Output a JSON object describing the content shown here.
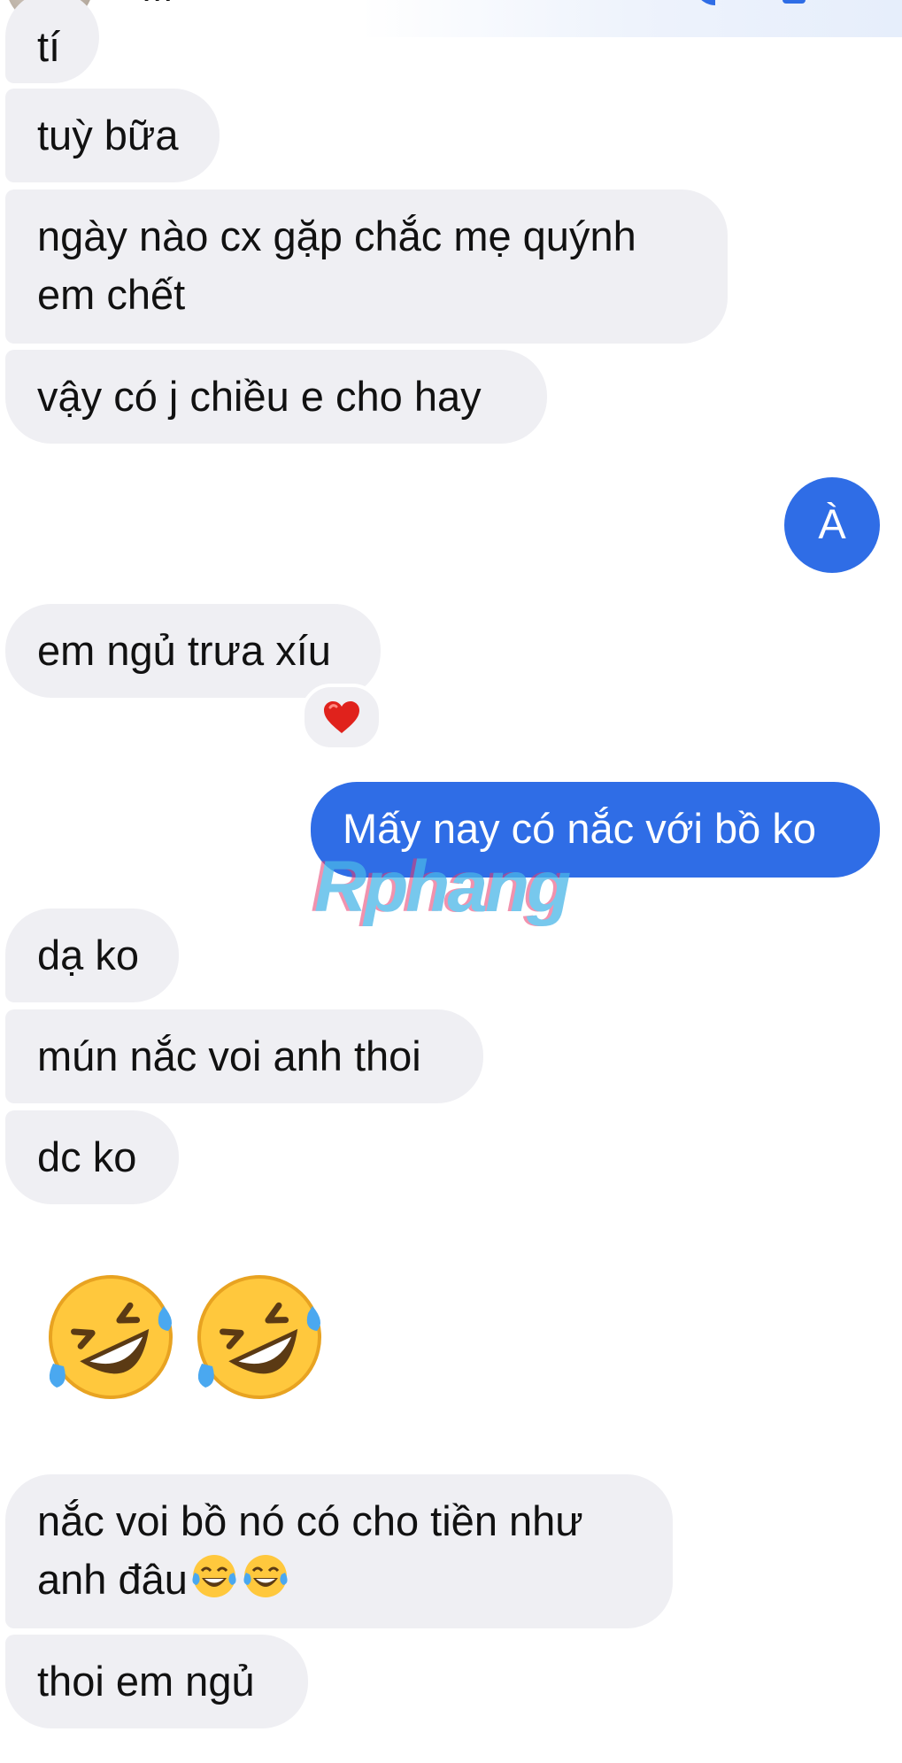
{
  "header": {
    "contact_name": "..."
  },
  "messages": {
    "m0": "tí",
    "m1": "tuỳ bữa",
    "m2": "ngày nào cx gặp chắc mẹ quýnh em chết",
    "m3": "vậy có j chiều e cho hay",
    "m4": "À",
    "m5": "em ngủ trưa xíu",
    "m6": "Mấy nay có nắc với bồ ko",
    "m7": "dạ ko",
    "m8": "mún nắc voi anh thoi",
    "m9": "dc ko",
    "m11": "nắc voi bồ nó có cho tiền như anh đâu",
    "m12": "thoi em ngủ"
  },
  "reaction": {
    "icon": "red-heart-icon"
  },
  "big_emoji": {
    "icon": "rolling-on-floor-laughing-icon",
    "count": 2
  },
  "inline_emoji": {
    "icon": "tears-of-joy-icon",
    "count": 2
  },
  "watermark": "Rphang",
  "colors": {
    "incoming_bubble": "#efeff3",
    "outgoing_bubble": "#2f6de6",
    "outgoing_text": "#ffffff"
  }
}
